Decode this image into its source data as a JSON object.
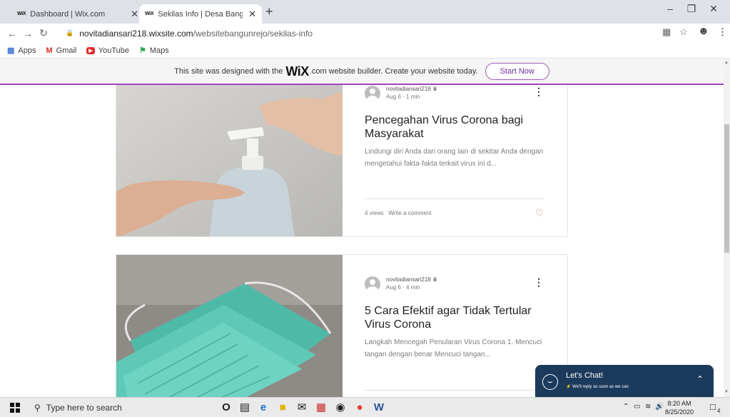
{
  "browser": {
    "tabs": [
      {
        "favicon": "WiX",
        "title": "Dashboard | Wix.com",
        "active": false
      },
      {
        "favicon": "WiX",
        "title": "Sekilas Info | Desa Bangun Rejo",
        "active": true
      }
    ],
    "close_glyph": "✕",
    "new_tab_glyph": "+",
    "url_host": "novitadiansari218.wixsite.com",
    "url_path": "/websitebangunrejo/sekilas-info",
    "bookmarks": [
      {
        "icon": "apps-grid-icon",
        "label": "Apps"
      },
      {
        "icon": "gmail-icon",
        "label": "Gmail"
      },
      {
        "icon": "youtube-icon",
        "label": "YouTube"
      },
      {
        "icon": "maps-icon",
        "label": "Maps"
      }
    ]
  },
  "banner": {
    "text_before": "This site was designed with the",
    "brand": "WiX",
    "text_after": ".com website builder. Create your website today.",
    "button": "Start Now"
  },
  "posts": [
    {
      "author": "novitadiansari218",
      "meta": "Aug 6 · 1 min",
      "title": "Pencegahan Virus Corona bagi Masyarakat",
      "excerpt": "Lindungi diri Anda dan orang lain di sekitar Anda dengan mengetahui fakta-fakta terkait virus ini d...",
      "views": "4 views",
      "comment": "Write a comment",
      "image": "hand-sanitizer-pump"
    },
    {
      "author": "novitadiansari218",
      "meta": "Aug 6 · 4 min",
      "title": "5 Cara Efektif agar Tidak Tertular Virus Corona",
      "excerpt": "Langkah Mencegah Penularan Virus Corona 1. Mencuci tangan dengan benar Mencuci tangan...",
      "image": "surgical-face-masks"
    }
  ],
  "chat": {
    "title": "Let's Chat!",
    "subtitle": "We'll reply as soon as we can"
  },
  "taskbar": {
    "search_placeholder": "Type here to search",
    "time": "8:20 AM",
    "date": "8/25/2020",
    "notification_count": "4"
  },
  "colors": {
    "accent_purple": "#a143c3",
    "chat_navy": "#1c3a5c",
    "heart_red": "#e8524a"
  }
}
